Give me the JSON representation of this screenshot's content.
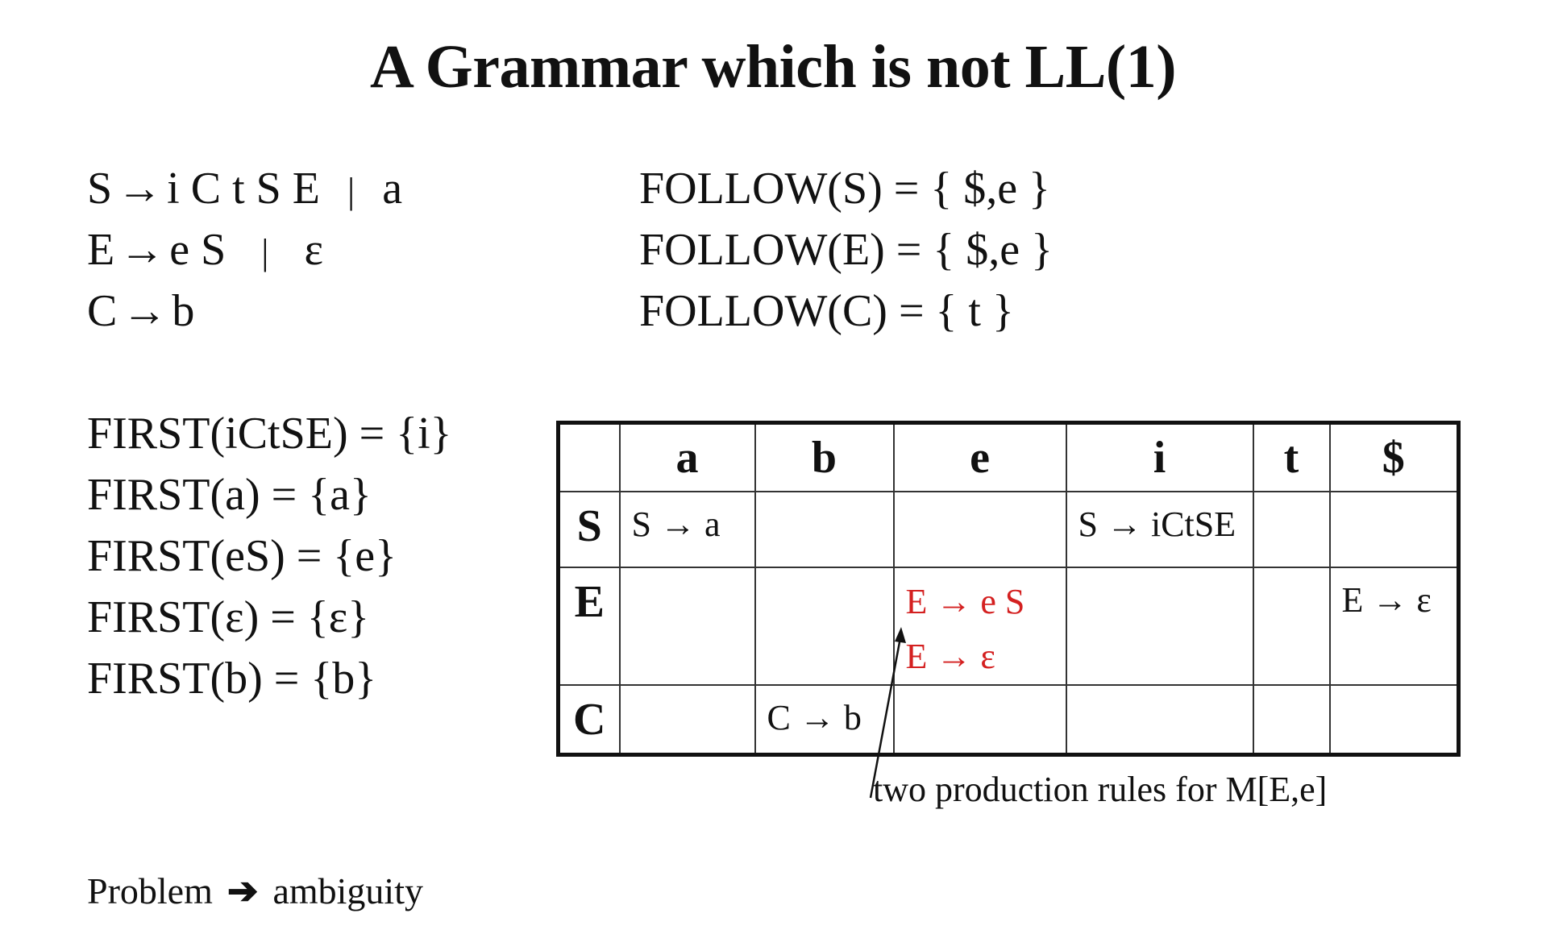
{
  "title": "A Grammar which is not LL(1)",
  "grammar": [
    {
      "lhs": "S",
      "arrow": "→",
      "rhs": "i C t S E",
      "bar": "|",
      "alt": "a"
    },
    {
      "lhs": "E",
      "arrow": "→",
      "rhs": "e S",
      "bar": "|",
      "alt": "ε"
    },
    {
      "lhs": "C",
      "arrow": "→",
      "rhs": "b",
      "bar": "",
      "alt": ""
    }
  ],
  "follow": [
    "FOLLOW(S) = { $,e }",
    "FOLLOW(E) = { $,e }",
    "FOLLOW(C) = { t }"
  ],
  "first": [
    "FIRST(iCtSE) = {i}",
    "FIRST(a) = {a}",
    "FIRST(eS) = {e}",
    "FIRST(ε) = {ε}",
    "FIRST(b) = {b}"
  ],
  "table": {
    "columns": [
      "a",
      "b",
      "e",
      "i",
      "t",
      "$"
    ],
    "rows": [
      {
        "label": "S",
        "cells": [
          "S → a",
          "",
          "",
          "S → iCtSE",
          "",
          ""
        ]
      },
      {
        "label": "E",
        "cells": [
          "",
          "",
          "E → e S\nE → ε",
          "",
          "",
          "E → ε"
        ]
      },
      {
        "label": "C",
        "cells": [
          "",
          "C → b",
          "",
          "",
          "",
          ""
        ]
      }
    ],
    "conflict_color": "#d42020"
  },
  "annotation": "two production rules for M[E,e]",
  "problem": {
    "label": "Problem",
    "arrow": "➔",
    "text": "ambiguity"
  }
}
